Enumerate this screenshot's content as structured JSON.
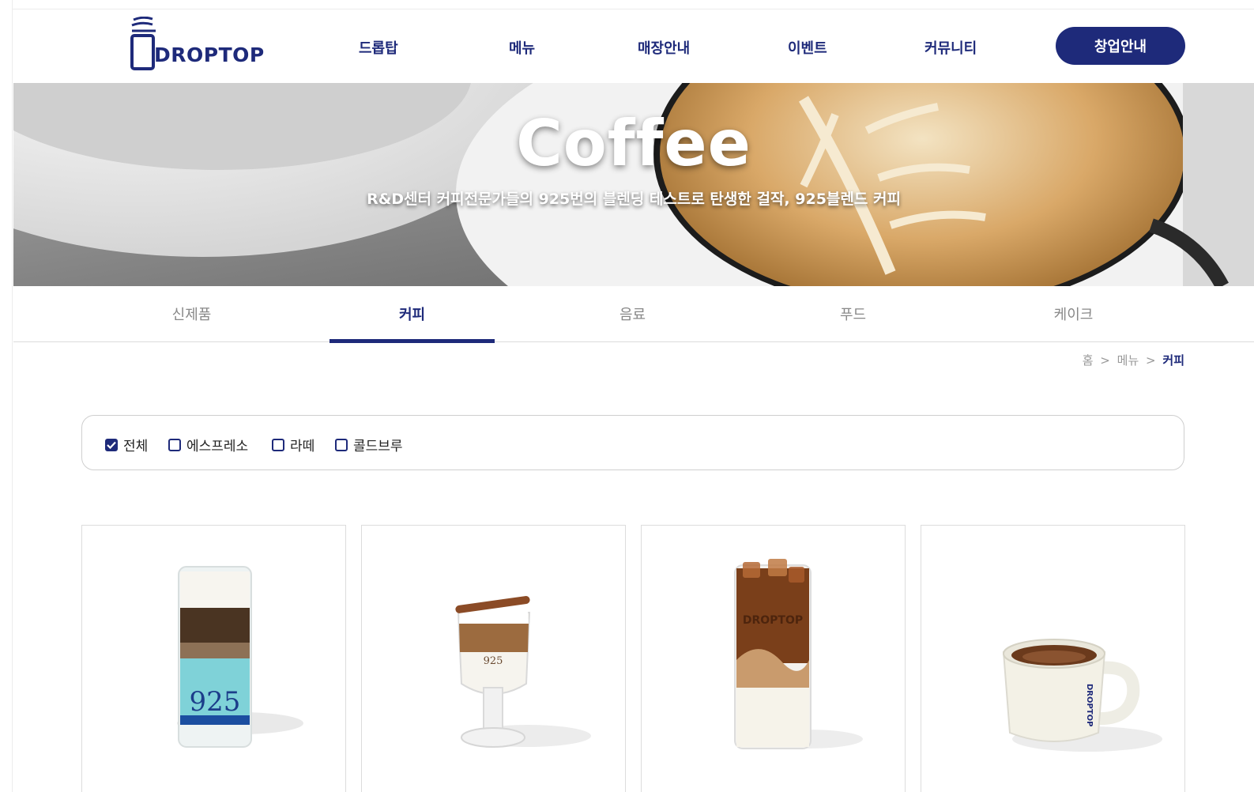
{
  "header": {
    "logo_text": "DROPTOP",
    "nav": [
      "드롭탑",
      "메뉴",
      "매장안내",
      "이벤트",
      "커뮤니티"
    ],
    "cta_label": "창업안내"
  },
  "hero": {
    "title": "Coffee",
    "subtitle": "R&D센터 커피전문가들의 925번의 블렌딩 테스트로 탄생한 걸작, 925블렌드 커피"
  },
  "tabs": [
    {
      "label": "신제품",
      "active": false
    },
    {
      "label": "커피",
      "active": true
    },
    {
      "label": "음료",
      "active": false
    },
    {
      "label": "푸드",
      "active": false
    },
    {
      "label": "케이크",
      "active": false
    }
  ],
  "breadcrumb": {
    "home": "홈",
    "menu": "메뉴",
    "current": "커피",
    "separator": ">"
  },
  "filters": [
    {
      "label": "전체",
      "checked": true
    },
    {
      "label": "에스프레소",
      "checked": false
    },
    {
      "label": "라떼",
      "checked": false
    },
    {
      "label": "콜드브루",
      "checked": false
    }
  ],
  "products": [
    {
      "icon": "layered-925-drink-image",
      "cup_text": "925"
    },
    {
      "icon": "cinnamon-latte-glass-image",
      "cup_text": "925"
    },
    {
      "icon": "iced-latte-glass-image",
      "cup_text": "DROPTOP"
    },
    {
      "icon": "hot-coffee-mug-image",
      "cup_text": "DROPTOP"
    }
  ],
  "colors": {
    "brand": "#1e2a7a",
    "tab_inactive": "#888888",
    "border": "#dcdcdc"
  }
}
